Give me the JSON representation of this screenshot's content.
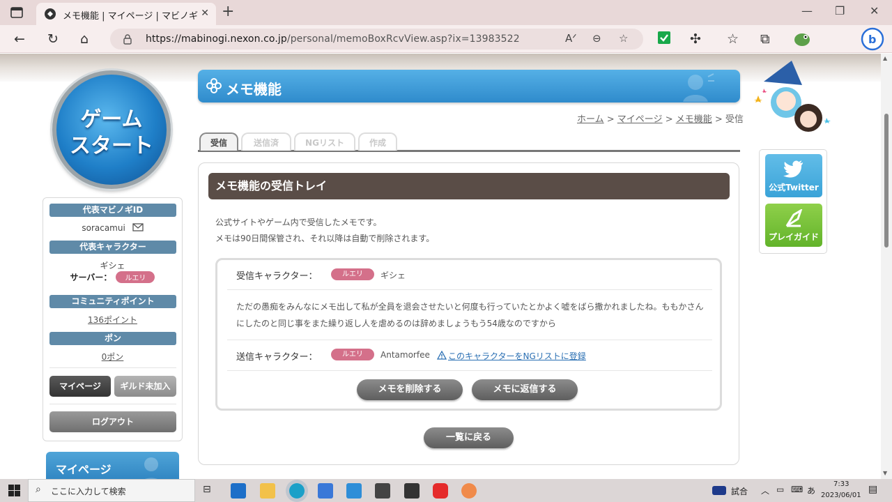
{
  "browser": {
    "tab_title": "メモ機能 | マイページ | マビノギ",
    "url_host": "https://mabinogi.nexon.co.jp",
    "url_path": "/personal/memoBoxRcvView.asp?ix=13983522"
  },
  "left": {
    "game_start_line1": "ゲーム",
    "game_start_line2": "スタート",
    "rep_id_head": "代表マビノギID",
    "rep_id": "soracamui",
    "rep_char_head": "代表キャラクター",
    "rep_char": "ギシェ",
    "server_label": "サーバー：",
    "server_name": "ルエリ",
    "community_head": "コミュニティポイント",
    "community_points": "136ポイント",
    "pon_head": "ポン",
    "pon_value": "0ポン",
    "mypage_btn": "マイページ",
    "guild_btn": "ギルド未加入",
    "logout_btn": "ログアウト",
    "mypage_box": "マイページ"
  },
  "main": {
    "title": "メモ機能",
    "breadcrumb": [
      "ホーム",
      "マイページ",
      "メモ機能",
      "受信"
    ],
    "tabs": [
      "受信",
      "送信済",
      "NGリスト",
      "作成"
    ],
    "inbox_title": "メモ機能の受信トレイ",
    "intro_line1": "公式サイトやゲーム内で受信したメモです。",
    "intro_line2": "メモは90日間保管され、それ以降は自動で削除されます。",
    "recv_label": "受信キャラクター：",
    "recv_server": "ルエリ",
    "recv_name": "ギシェ",
    "memo_text": "ただの愚痴をみんなにメモ出して私が全員を退会させたいと何度も行っていたとかよく嘘をばら撒かれましたね。ももかさんにしたのと同じ事をまた繰り返し人を虐めるのは辞めましょうもう54歳なのですから",
    "send_label": "送信キャラクター：",
    "send_server": "ルエリ",
    "send_name": "Antamorfee",
    "ng_link": "このキャラクターをNGリストに登録",
    "delete_btn": "メモを削除する",
    "reply_btn": "メモに返信する",
    "back_btn": "一覧に戻る"
  },
  "right": {
    "twitter": "公式Twitter",
    "guide": "プレイガイド"
  },
  "taskbar": {
    "search_placeholder": "ここに入力して検索",
    "weather": "試合",
    "ime": "あ",
    "time": "7:33",
    "date": "2023/06/01"
  },
  "colors": {
    "accent_blue": "#2f8bcc",
    "server_pink": "#d4708a",
    "inbox_head": "#5a4d47"
  }
}
